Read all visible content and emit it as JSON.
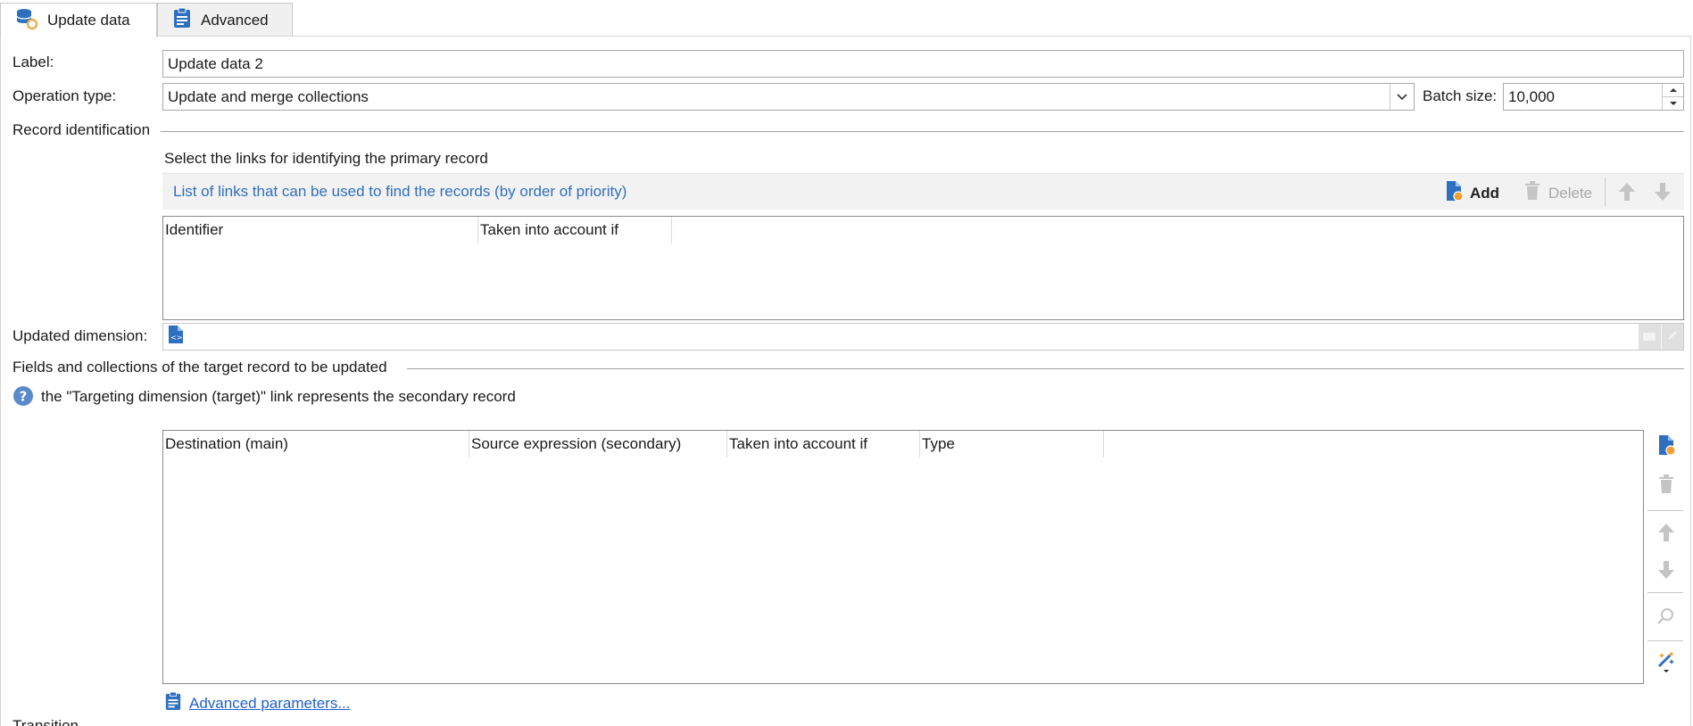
{
  "tabs": [
    {
      "label": "Update data",
      "active": true,
      "icon": "database-sync-icon"
    },
    {
      "label": "Advanced",
      "active": false,
      "icon": "clipboard-icon"
    }
  ],
  "form": {
    "label_caption": "Label:",
    "label_value": "Update data 2",
    "operation_caption": "Operation type:",
    "operation_value": "Update and merge collections",
    "batch_caption": "Batch size:",
    "batch_value": "10,000"
  },
  "record_identification": {
    "section_title": "Record identification",
    "instruction": "Select the links for identifying the primary record",
    "list_title": "List of links that can be used to find the records (by order of priority)",
    "add_label": "Add",
    "delete_label": "Delete",
    "columns": [
      "Identifier",
      "Taken into account if"
    ]
  },
  "dimension": {
    "caption": "Updated dimension:",
    "value": ""
  },
  "fields": {
    "section_title": "Fields and collections of the target record to be updated",
    "info_text": "the \"Targeting dimension (target)\" link represents the secondary record",
    "columns": [
      "Destination (main)",
      "Source expression (secondary)",
      "Taken into account if",
      "Type"
    ]
  },
  "advanced_link": "Advanced parameters...",
  "bottom_partial_label": "Transition",
  "colors": {
    "accent_blue": "#2f6fc0",
    "link_blue": "#1f5fd0",
    "icon_orange": "#f0a030",
    "disabled_gray": "#a8a8a8"
  }
}
